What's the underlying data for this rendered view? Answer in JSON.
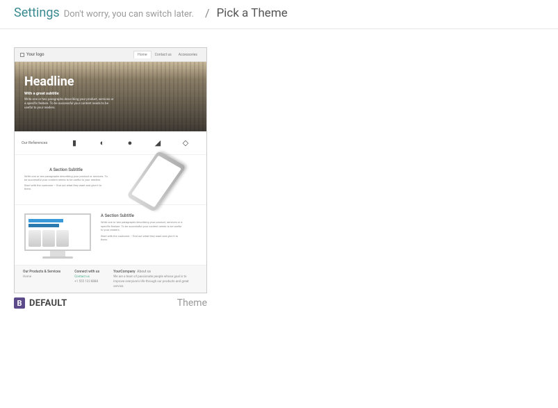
{
  "header": {
    "settings": "Settings",
    "hint": "Don't worry, you can switch later.",
    "separator": "/",
    "current": "Pick a Theme"
  },
  "theme": {
    "badge_letter": "B",
    "name": "DEFAULT",
    "type_label": "Theme",
    "preview": {
      "nav": {
        "logo_text": "Your logo",
        "items": [
          "Home",
          "Contact us",
          "Accessories"
        ]
      },
      "hero": {
        "headline": "Headline",
        "subtitle": "With a great subtitle",
        "desc": "Write one or two paragraphs describing your product, services or a specific feature. To be successful your content needs to be useful to your readers."
      },
      "references": {
        "label": "Our References"
      },
      "section1": {
        "title": "A Section Subtitle",
        "desc1": "Write one or two paragraphs describing your product or services. To be successful your content needs to be useful to your readers.",
        "desc2": "Start with the customer – find out what they want and give it to them."
      },
      "section2": {
        "title": "A Section Subtitle",
        "desc1": "Write one or two paragraphs describing your product, services or a specific feature. To be successful your content needs to be useful to your readers.",
        "desc2": "Start with the customer – find out what they want and give it to them."
      },
      "footer": {
        "col1_h": "Our Products & Services",
        "col1_l1": "Home",
        "col2_h": "Connect with us",
        "col2_l1": "Contact us",
        "col2_l2": "+1 555 123 8888",
        "col3_h": "YourCompany",
        "col3_about": "About us",
        "col3_desc": "We are a team of passionate people whose goal is to improve everyone's life through our products and great service."
      }
    }
  }
}
